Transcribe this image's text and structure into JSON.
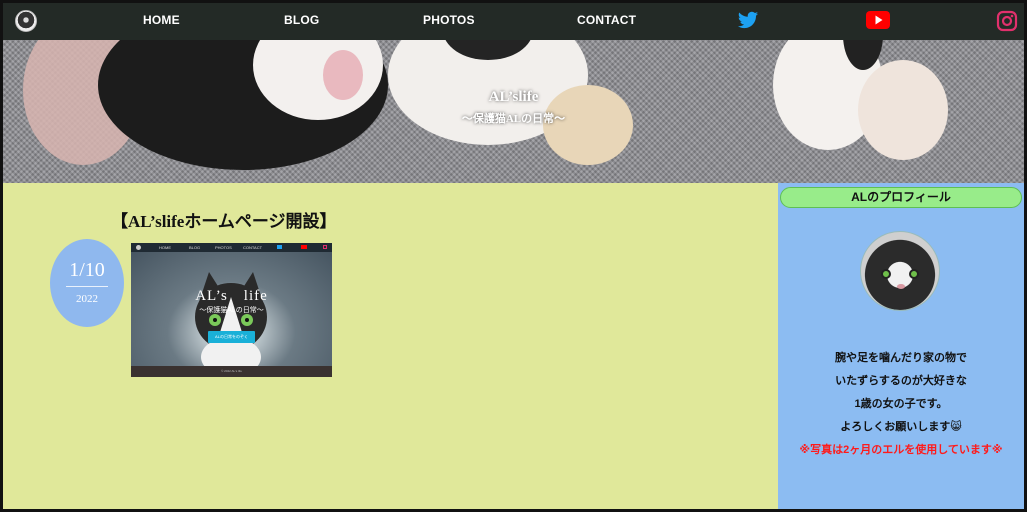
{
  "nav": {
    "items": [
      "HOME",
      "BLOG",
      "PHOTOS",
      "CONTACT"
    ],
    "icons": [
      "cat-logo-icon",
      "twitter-icon",
      "youtube-icon",
      "instagram-icon"
    ]
  },
  "hero": {
    "title": "AL’slife",
    "subtitle": "〜保護猫ALの日常〜"
  },
  "post": {
    "title": "【AL’slifeホームページ開設】",
    "date_md": "1/10",
    "date_year": "2022",
    "thumbnail": {
      "nav_items": [
        "HOME",
        "BLOG",
        "PHOTOS",
        "CONTACT"
      ],
      "title": "AL’s　life",
      "subtitle": "〜保護猫ALの日常〜",
      "button": "ALの日常をのぞく",
      "footer": "© 2022 AL's life"
    }
  },
  "sidebar": {
    "heading": "ALのプロフィール",
    "bio": [
      "腕や足を噛んだり家の物で",
      "いたずらするのが大好きな",
      "1歳の女の子です。",
      "よろしくお願いします😸"
    ],
    "note": "※写真は2ヶ月のエルを使用しています※"
  },
  "colors": {
    "nav_bg": "#232a26",
    "main_bg": "#e0e89a",
    "sidebar_bg": "#8cbcf2",
    "sidebar_heading_bg": "#98ec8a",
    "date_badge": "#8fb8ee",
    "twitter": "#1da1f2",
    "youtube": "#ff0000",
    "instagram": "#e1306c",
    "note_text": "#ff1a1a"
  }
}
